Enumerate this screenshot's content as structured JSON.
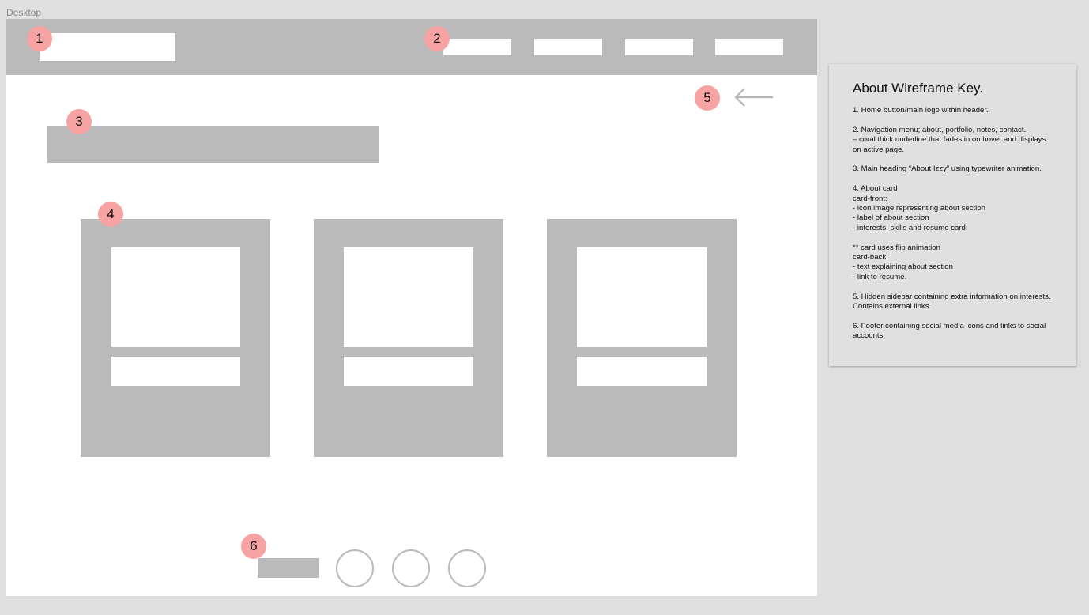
{
  "frame": {
    "label": "Desktop"
  },
  "markers": [
    "1",
    "2",
    "3",
    "4",
    "5",
    "6"
  ],
  "key": {
    "title": "About Wireframe Key.",
    "items": [
      "1. Home button/main logo within header.",
      "2. Navigation menu; about, portfolio, notes, contact.\n– coral thick underline that fades in on hover and displays on active page.",
      "3. Main heading “About Izzy” using typewriter animation.",
      "4. About card\ncard-front:\n- icon image representing about section\n- label of about section\n- interests, skills and resume card.",
      "** card uses flip animation\ncard-back:\n- text explaining about section\n- link to resume.",
      "5. Hidden sidebar containing extra information on interests. Contains external links.",
      "6. Footer containing social media icons and links to social accounts."
    ]
  },
  "colors": {
    "background": "#e0e0e0",
    "placeholder": "#bababa",
    "marker": "#f8a3a3",
    "frame": "#ffffff"
  },
  "icons": {
    "sidebar_toggle": "arrow-left-icon",
    "social": "circle-outline-icon"
  }
}
